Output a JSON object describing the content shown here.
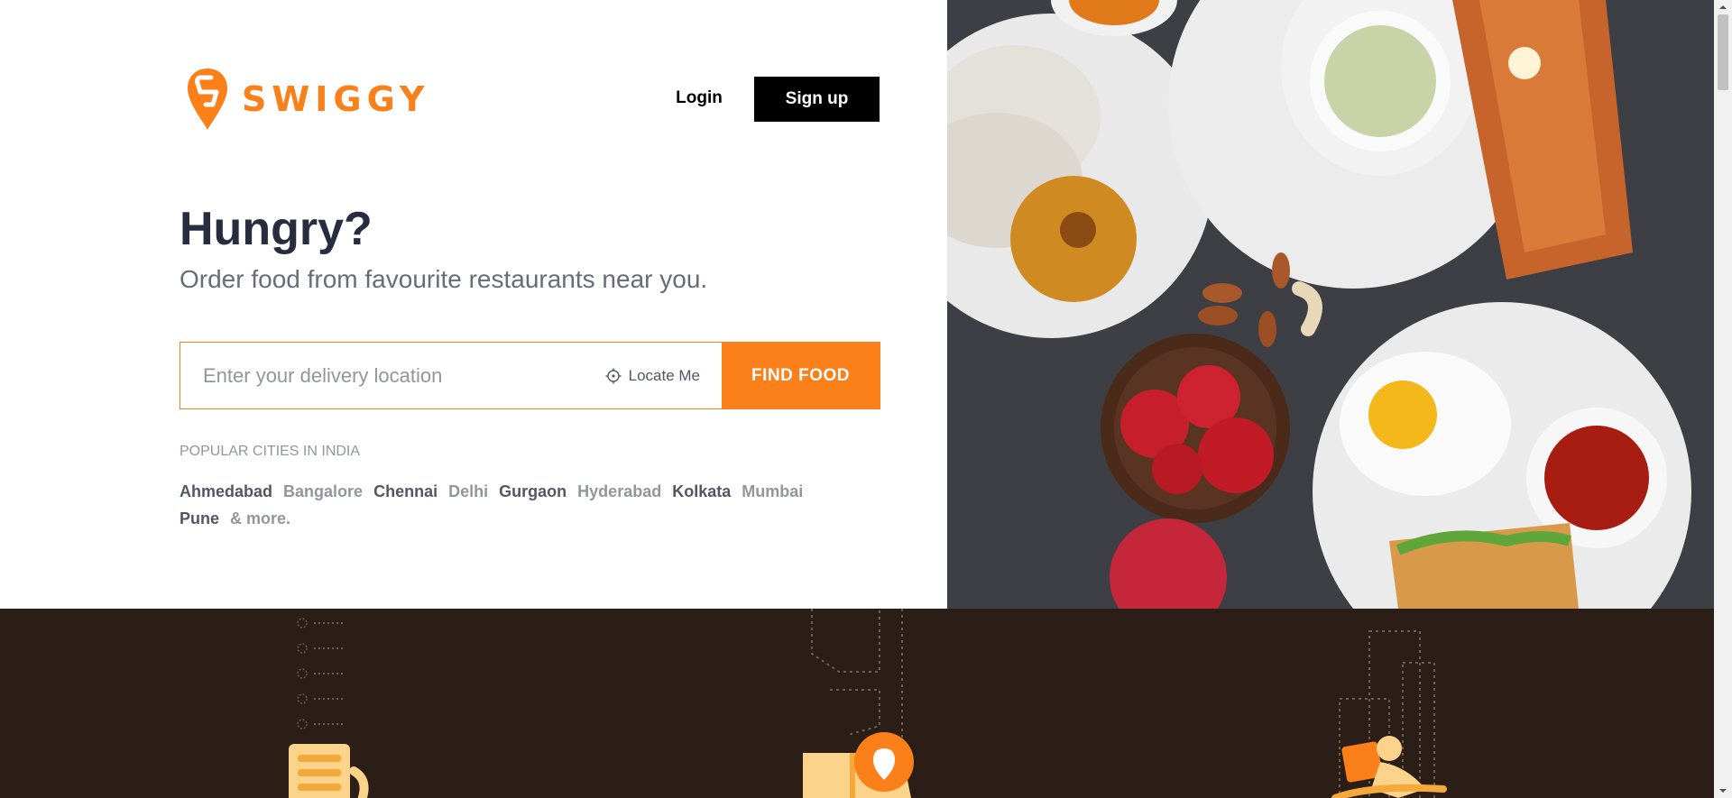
{
  "brand": {
    "name": "SWIGGY",
    "color": "#fc8019"
  },
  "header": {
    "login_label": "Login",
    "signup_label": "Sign up"
  },
  "hero": {
    "title": "Hungry?",
    "subtitle": "Order food from favourite restaurants near you."
  },
  "search": {
    "placeholder": "Enter your delivery location",
    "value": "",
    "locate_label": "Locate Me",
    "button_label": "FIND FOOD"
  },
  "popular": {
    "label": "POPULAR CITIES IN INDIA",
    "cities": [
      "Ahmedabad",
      "Bangalore",
      "Chennai",
      "Delhi",
      "Gurgaon",
      "Hyderabad",
      "Kolkata",
      "Mumbai",
      "Pune"
    ],
    "more_label": "& more."
  },
  "icons": [
    "swiggy-logo-icon",
    "crosshair-icon",
    "menu-list-icon",
    "location-pin-icon",
    "delivery-scooter-icon"
  ],
  "colors": {
    "accent": "#fc8019",
    "text_dark": "#282c3f",
    "text_muted": "#686b78",
    "band_bg": "#2b1e16",
    "food_bg": "#3b3d43"
  }
}
